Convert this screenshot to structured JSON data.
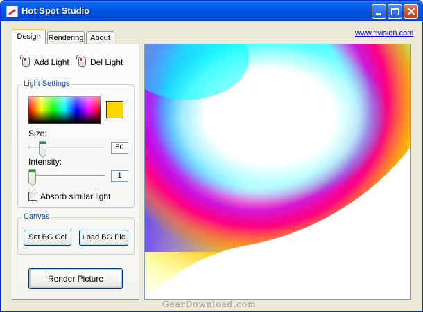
{
  "window": {
    "title": "Hot Spot Studio",
    "link": "www.rlvision.com"
  },
  "tabs": [
    {
      "label": "Design",
      "active": true
    },
    {
      "label": "Rendering",
      "active": false
    },
    {
      "label": "About",
      "active": false
    }
  ],
  "toolbar": {
    "add_light": "Add Light",
    "del_light": "Del Light"
  },
  "light_settings": {
    "group_title": "Light Settings",
    "selected_color": "#ffd700",
    "size_label": "Size:",
    "size_value": "50",
    "size_level": 0.15,
    "intensity_label": "Intensity:",
    "intensity_value": "1",
    "intensity_level": 0.0,
    "absorb_label": "Absorb similar light",
    "absorb_checked": false
  },
  "canvas_group": {
    "group_title": "Canvas",
    "set_bg_label": "Set BG Col",
    "load_bg_label": "Load BG Pic"
  },
  "render_label": "Render Picture",
  "watermark": "GearDownload.com",
  "colors": {
    "titlebar": "#0055e5",
    "group_title": "#0046d5",
    "link": "#0000ff"
  }
}
